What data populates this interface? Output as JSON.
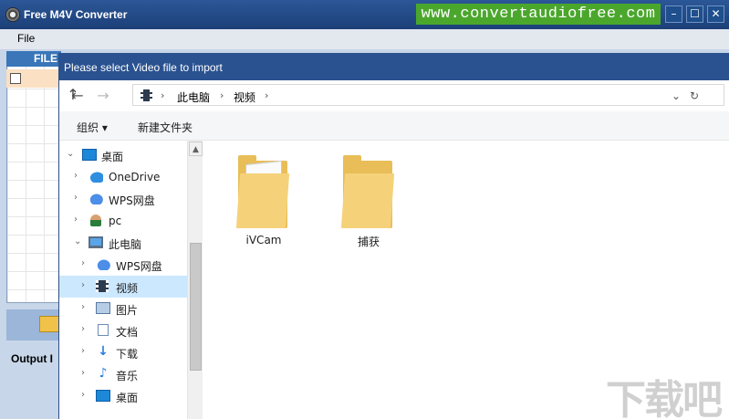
{
  "app": {
    "title": "Free M4V Converter",
    "banner_url": "www.convertaudiofree.com",
    "menu": [
      "File"
    ],
    "file_column_header": "FILE",
    "output_label": "Output I"
  },
  "dialog": {
    "title": "Please select Video file to import",
    "breadcrumb": [
      "此电脑",
      "视频"
    ],
    "toolbar": {
      "organize": "组织 ▾",
      "new_folder": "新建文件夹"
    },
    "tree": [
      {
        "label": "桌面",
        "icon": "desktop-icon",
        "chevron": "expanded"
      },
      {
        "label": "OneDrive",
        "icon": "onedrive-icon",
        "chevron": "collapsed"
      },
      {
        "label": "WPS网盘",
        "icon": "wps-cloud-icon",
        "chevron": "collapsed"
      },
      {
        "label": "pc",
        "icon": "user-icon",
        "chevron": "collapsed"
      },
      {
        "label": "此电脑",
        "icon": "computer-icon",
        "chevron": "expanded"
      },
      {
        "label": "WPS网盘",
        "icon": "wps-cloud-icon",
        "chevron": "collapsed"
      },
      {
        "label": "视频",
        "icon": "video-icon",
        "chevron": "collapsed",
        "selected": true
      },
      {
        "label": "图片",
        "icon": "pictures-icon",
        "chevron": "collapsed"
      },
      {
        "label": "文档",
        "icon": "documents-icon",
        "chevron": "collapsed"
      },
      {
        "label": "下载",
        "icon": "download-icon",
        "chevron": "collapsed"
      },
      {
        "label": "音乐",
        "icon": "music-icon",
        "chevron": "collapsed"
      },
      {
        "label": "桌面",
        "icon": "desktop-icon",
        "chevron": "collapsed"
      }
    ],
    "folders": [
      {
        "name": "iVCam"
      },
      {
        "name": "捕获"
      }
    ]
  },
  "watermark": "下载吧",
  "colors": {
    "titlebar": "#1d3f78",
    "banner": "#4aa72c",
    "selection": "#cce8ff",
    "folder": "#e9bd58"
  }
}
